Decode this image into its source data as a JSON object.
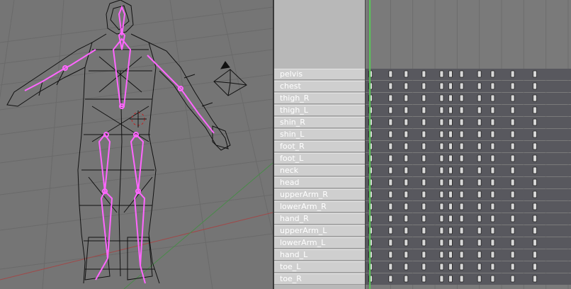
{
  "viewport": {
    "type": "3d-view",
    "object": "armature-wireframe",
    "camera": "camera-icon",
    "cursor": "3d-cursor-icon"
  },
  "action_editor": {
    "channels": [
      "pelvis",
      "chest",
      "thigh_R",
      "thigh_L",
      "shin_R",
      "shin_L",
      "foot_R",
      "foot_L",
      "neck",
      "head",
      "upperArm_R",
      "lowerArm_R",
      "hand_R",
      "upperArm_L",
      "lowerArm_L",
      "hand_L",
      "toe_L",
      "toe_R"
    ],
    "keyframe_frames": [
      1,
      10,
      17,
      25,
      33,
      37,
      42,
      50,
      56,
      65,
      75
    ],
    "current_frame": 1,
    "frame_range": [
      0,
      90
    ]
  },
  "colors": {
    "bone": "#ff66ff",
    "current_frame_line": "#58c858",
    "keyframe": "#d8d8d8",
    "channel_row": "#58585e"
  }
}
